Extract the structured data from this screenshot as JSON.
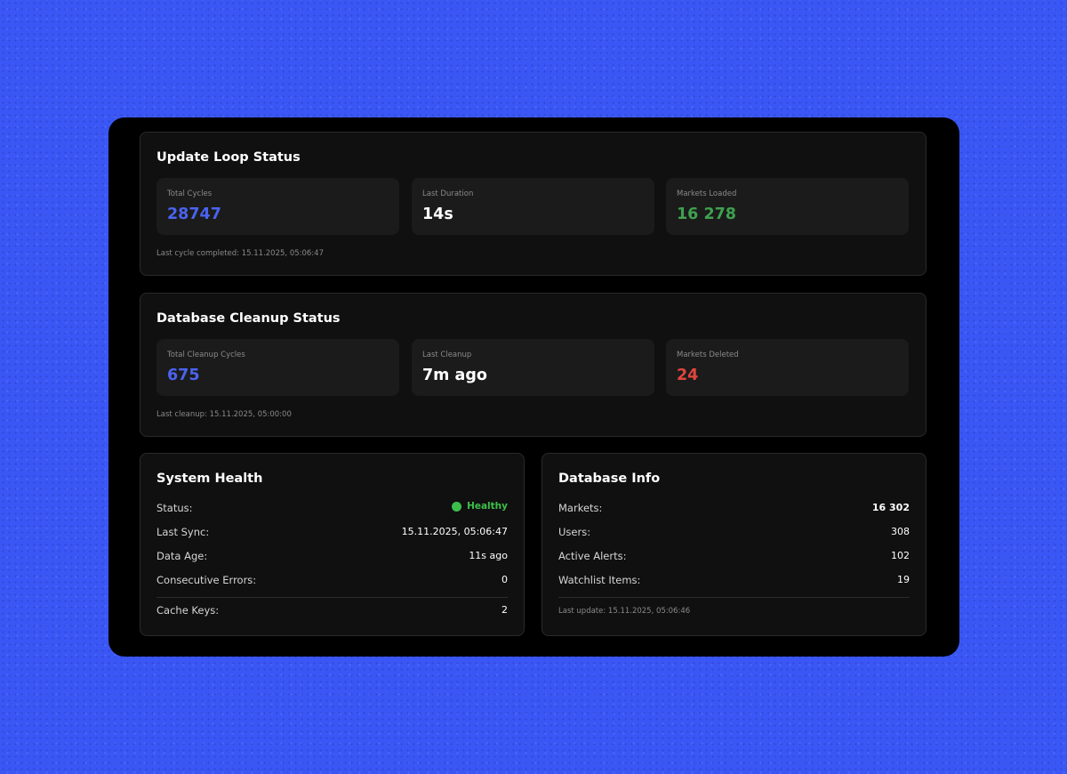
{
  "update_loop": {
    "title": "Update Loop Status",
    "stats": [
      {
        "label": "Total Cycles",
        "value": "28747"
      },
      {
        "label": "Last Duration",
        "value": "14s"
      },
      {
        "label": "Markets Loaded",
        "value": "16 278"
      }
    ],
    "footer": "Last cycle completed: 15.11.2025, 05:06:47"
  },
  "cleanup": {
    "title": "Database Cleanup Status",
    "stats": [
      {
        "label": "Total Cleanup Cycles",
        "value": "675"
      },
      {
        "label": "Last Cleanup",
        "value": "7m ago"
      },
      {
        "label": "Markets Deleted",
        "value": "24"
      }
    ],
    "footer": "Last cleanup: 15.11.2025, 05:00:00"
  },
  "system_health": {
    "title": "System Health",
    "rows": [
      {
        "label": "Status:",
        "value": "Healthy"
      },
      {
        "label": "Last Sync:",
        "value": "15.11.2025, 05:06:47"
      },
      {
        "label": "Data Age:",
        "value": "11s ago"
      },
      {
        "label": "Consecutive Errors:",
        "value": "0"
      },
      {
        "label": "Cache Keys:",
        "value": "2"
      }
    ]
  },
  "database_info": {
    "title": "Database Info",
    "rows": [
      {
        "label": "Markets:",
        "value": "16 302"
      },
      {
        "label": "Users:",
        "value": "308"
      },
      {
        "label": "Active Alerts:",
        "value": "102"
      },
      {
        "label": "Watchlist Items:",
        "value": "19"
      }
    ],
    "footer": "Last update: 15.11.2025, 05:06:46"
  },
  "colors": {
    "background": "#3a57f5",
    "accent_blue": "#4a63f0",
    "success_green": "#3fa14e",
    "healthy_green": "#3cbf4a",
    "danger_red": "#e0463d"
  },
  "icons": {
    "status": "status-dot-icon"
  }
}
